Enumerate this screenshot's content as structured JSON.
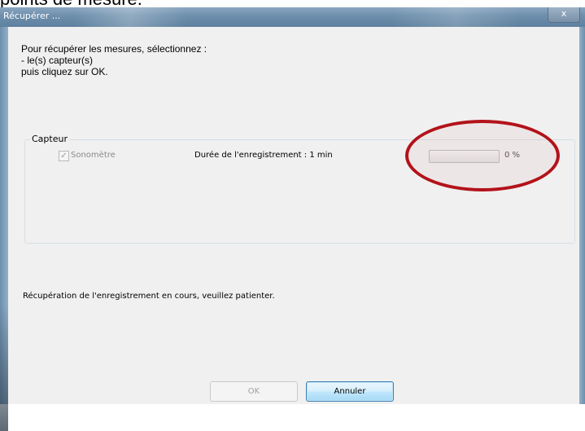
{
  "background_fragment": "points de mesure.",
  "window": {
    "title": "Récupérer ...",
    "close_label": "x"
  },
  "instructions": {
    "line1": "Pour récupérer les mesures, sélectionnez :",
    "line2": "- le(s) capteur(s)",
    "line3": "puis cliquez sur OK."
  },
  "sensor_group": {
    "label": "Capteur",
    "sensor": {
      "name": "Sonomètre",
      "checked": true,
      "enabled": false,
      "duration_label": "Durée de l'enregistrement : 1 min",
      "progress_percent": 0,
      "progress_text": "0 %"
    }
  },
  "status": {
    "text": "Récupération de l'enregistrement en cours, veuillez patienter."
  },
  "buttons": {
    "ok_label": "OK",
    "ok_enabled": false,
    "cancel_label": "Annuler"
  },
  "colors": {
    "annotation_ellipse": "#b3121a",
    "titlebar": "#6f90ad",
    "default_button_border": "#3c7fb1"
  }
}
